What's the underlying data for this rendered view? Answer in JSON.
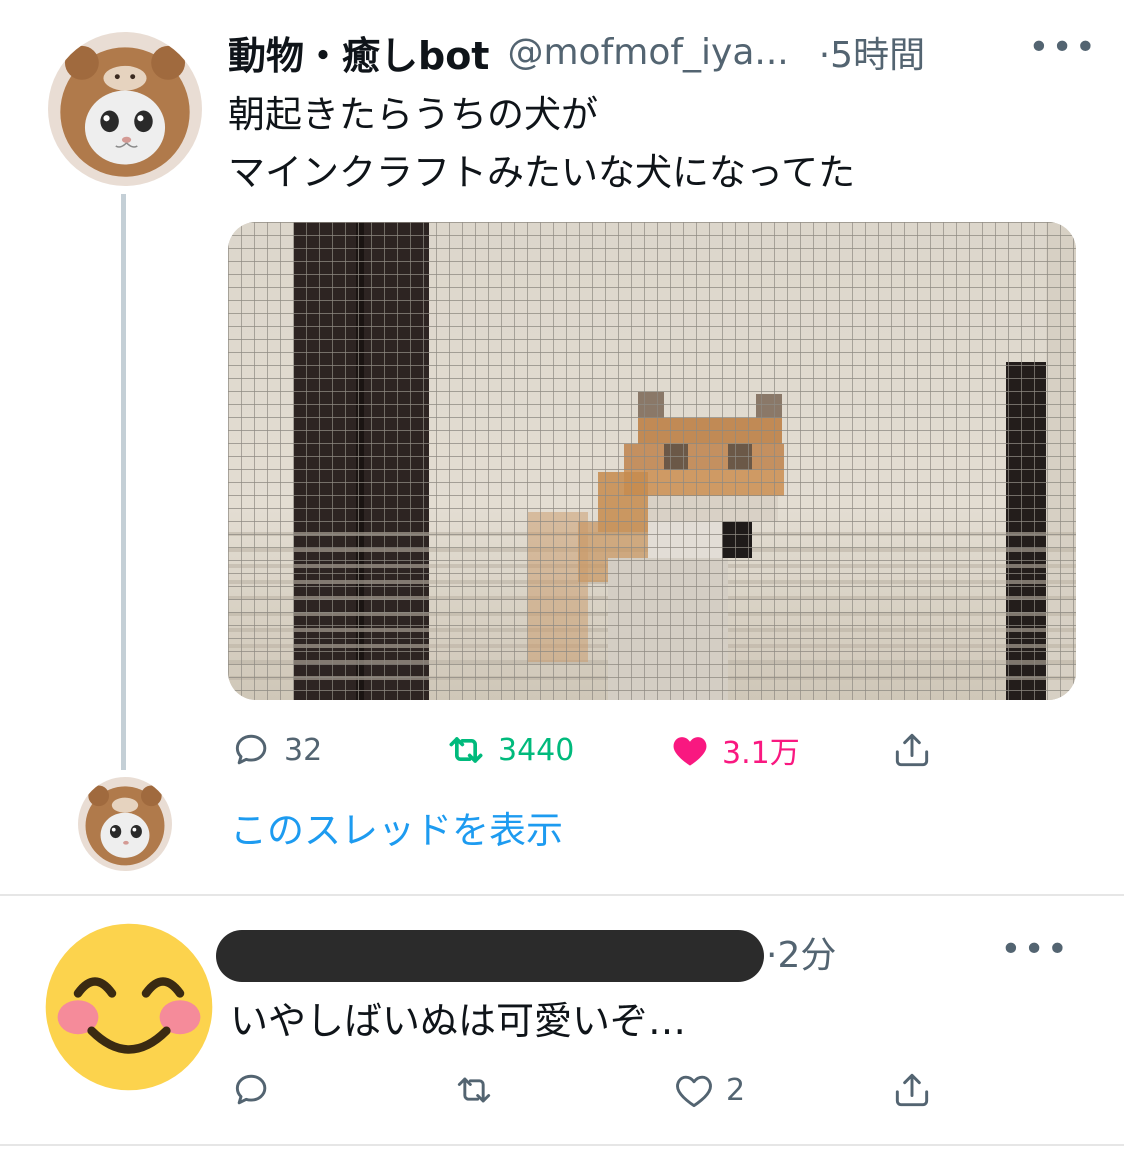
{
  "tweet": {
    "display_name": "動物・癒しbot",
    "handle": "@mofmof_iya...",
    "time": "·5時間",
    "more": "•••",
    "text": "朝起きたらうちの犬が\nマインクラフトみたいな犬になってた",
    "actions": {
      "reply_count": "32",
      "retweet_count": "3440",
      "like_count": "3.1万"
    },
    "liked": true,
    "retweeted": true
  },
  "show_thread_label": "このスレッドを表示",
  "reply": {
    "time": "·2分",
    "more": "•••",
    "text": "いやしばいぬは可愛いぞ…",
    "actions": {
      "like_count": "2"
    }
  },
  "colors": {
    "accent": "#1d9bf0",
    "retweet_green": "#00ba7c",
    "like_pink": "#f91880",
    "muted": "#536471"
  },
  "icons": {
    "reply": "speech-bubble-icon",
    "retweet": "retweet-arrows-icon",
    "like": "heart-icon",
    "share": "share-upload-icon"
  }
}
